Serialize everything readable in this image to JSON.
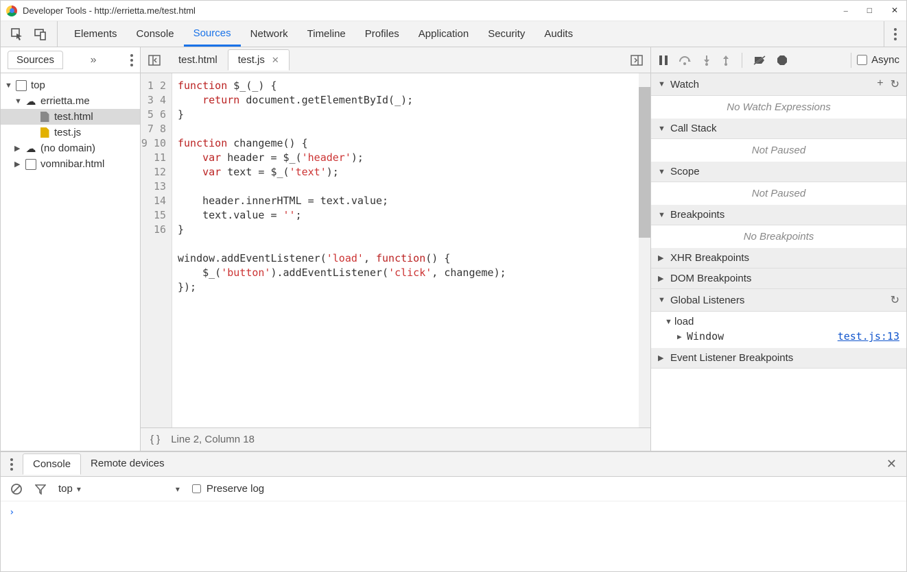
{
  "window": {
    "title": "Developer Tools - http://errietta.me/test.html"
  },
  "mainTabs": [
    "Elements",
    "Console",
    "Sources",
    "Network",
    "Timeline",
    "Profiles",
    "Application",
    "Security",
    "Audits"
  ],
  "mainTabActive": "Sources",
  "sidebar": {
    "header": "Sources",
    "tree": {
      "top": "top",
      "domain": "errietta.me",
      "file_html": "test.html",
      "file_js": "test.js",
      "nodomain": "(no domain)",
      "vomnibar": "vomnibar.html"
    }
  },
  "editor": {
    "tabs": [
      {
        "label": "test.html",
        "active": false,
        "closable": false
      },
      {
        "label": "test.js",
        "active": true,
        "closable": true
      }
    ],
    "lineCount": 16,
    "code_lines": [
      {
        "tokens": [
          [
            "kw",
            "function"
          ],
          [
            "",
            " $_(_) {"
          ]
        ]
      },
      {
        "tokens": [
          [
            "",
            "    "
          ],
          [
            "kw",
            "return"
          ],
          [
            "",
            " document.getElementById(_);"
          ]
        ]
      },
      {
        "tokens": [
          [
            "",
            "}"
          ]
        ]
      },
      {
        "tokens": [
          [
            "",
            ""
          ]
        ]
      },
      {
        "tokens": [
          [
            "kw",
            "function"
          ],
          [
            "",
            " changeme() {"
          ]
        ]
      },
      {
        "tokens": [
          [
            "",
            "    "
          ],
          [
            "kw",
            "var"
          ],
          [
            "",
            " header = $_("
          ],
          [
            "str",
            "'header'"
          ],
          [
            "",
            ");"
          ]
        ]
      },
      {
        "tokens": [
          [
            "",
            "    "
          ],
          [
            "kw",
            "var"
          ],
          [
            "",
            " text = $_("
          ],
          [
            "str",
            "'text'"
          ],
          [
            "",
            ");"
          ]
        ]
      },
      {
        "tokens": [
          [
            "",
            ""
          ]
        ]
      },
      {
        "tokens": [
          [
            "",
            "    header.innerHTML = text.value;"
          ]
        ]
      },
      {
        "tokens": [
          [
            "",
            "    text.value = "
          ],
          [
            "str",
            "''"
          ],
          [
            "",
            ";"
          ]
        ]
      },
      {
        "tokens": [
          [
            "",
            "}"
          ]
        ]
      },
      {
        "tokens": [
          [
            "",
            ""
          ]
        ]
      },
      {
        "tokens": [
          [
            "",
            "window.addEventListener("
          ],
          [
            "str",
            "'load'"
          ],
          [
            "",
            ", "
          ],
          [
            "kw",
            "function"
          ],
          [
            "",
            "() {"
          ]
        ]
      },
      {
        "tokens": [
          [
            "",
            "    $_("
          ],
          [
            "str",
            "'button'"
          ],
          [
            "",
            ").addEventListener("
          ],
          [
            "str",
            "'click'"
          ],
          [
            "",
            ", changeme);"
          ]
        ]
      },
      {
        "tokens": [
          [
            "",
            "});"
          ]
        ]
      },
      {
        "tokens": [
          [
            "",
            ""
          ]
        ]
      }
    ],
    "status": "Line 2, Column 18"
  },
  "debugger": {
    "async_label": "Async",
    "sections": {
      "watch": {
        "title": "Watch",
        "body": "No Watch Expressions"
      },
      "callstack": {
        "title": "Call Stack",
        "body": "Not Paused"
      },
      "scope": {
        "title": "Scope",
        "body": "Not Paused"
      },
      "breakpoints": {
        "title": "Breakpoints",
        "body": "No Breakpoints"
      },
      "xhr": {
        "title": "XHR Breakpoints"
      },
      "dom": {
        "title": "DOM Breakpoints"
      },
      "global": {
        "title": "Global Listeners",
        "event": "load",
        "target": "Window",
        "link": "test.js:13"
      },
      "evlistener": {
        "title": "Event Listener Breakpoints"
      }
    }
  },
  "drawer": {
    "tabs": [
      "Console",
      "Remote devices"
    ],
    "activeTab": "Console",
    "context": "top",
    "preserve_label": "Preserve log"
  }
}
